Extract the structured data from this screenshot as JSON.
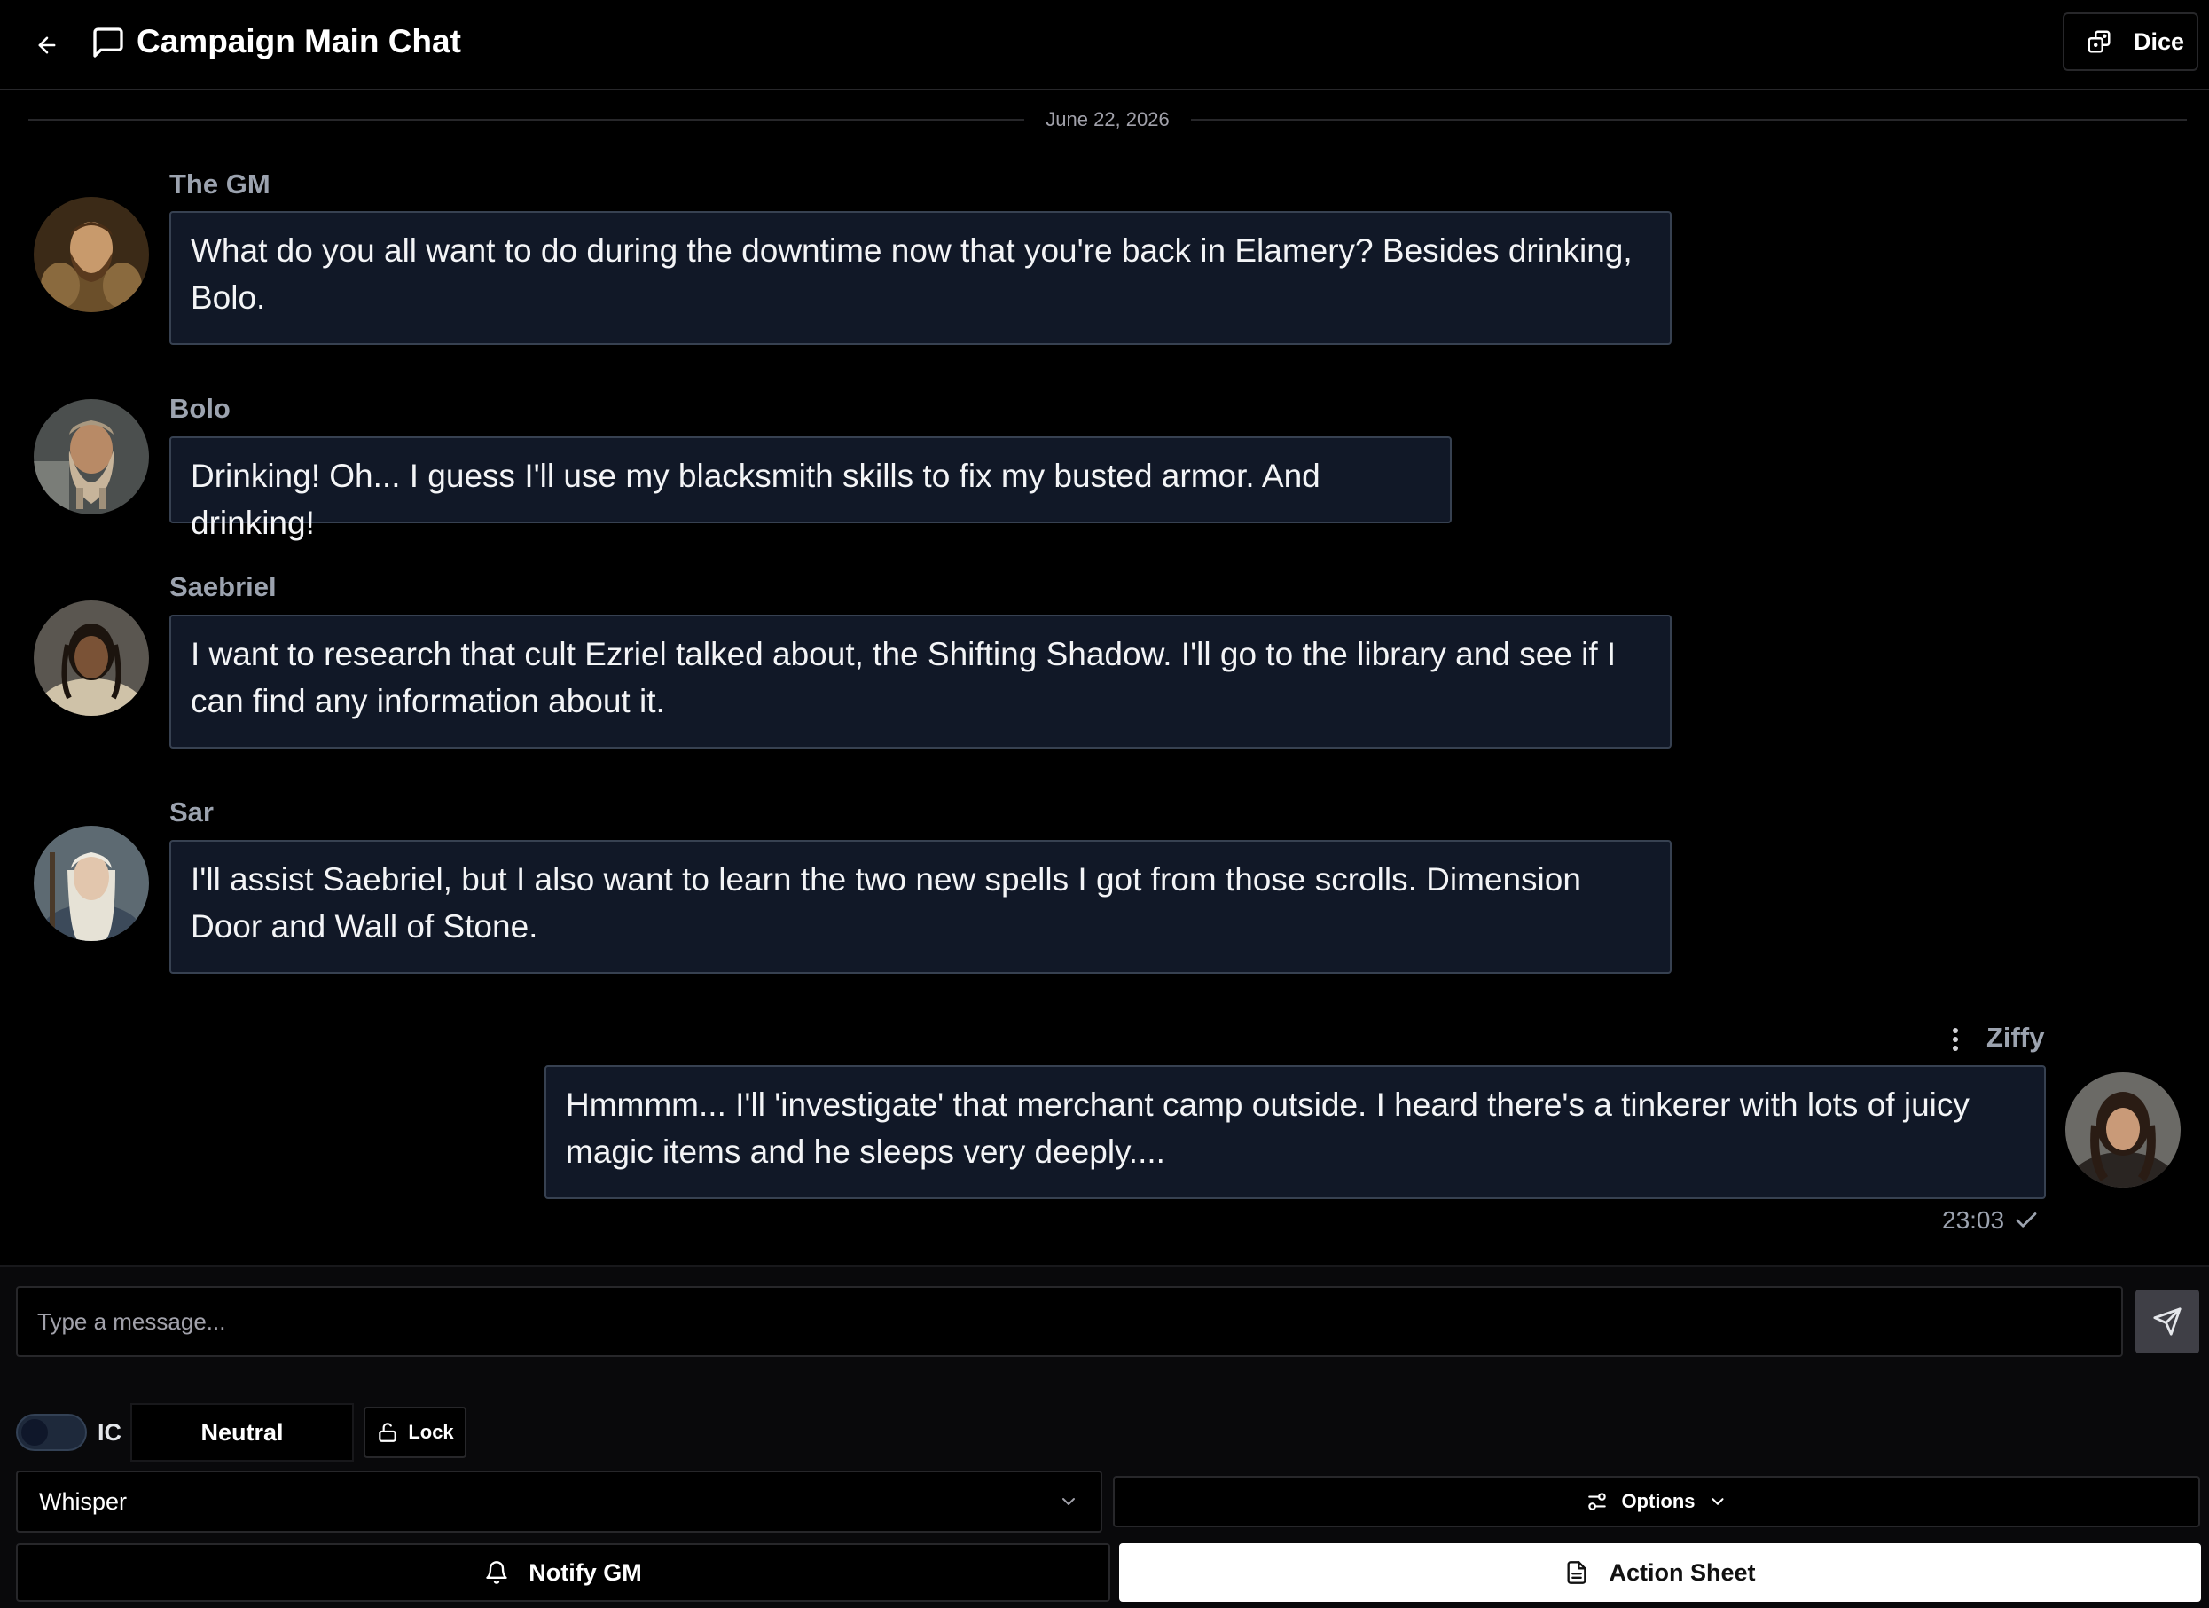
{
  "header": {
    "title": "Campaign Main Chat",
    "dice_label": "Dice"
  },
  "date_divider": "June 22, 2026",
  "messages": [
    {
      "sender": "The GM",
      "text": "What do you all want to do during the downtime now that you're back in Elamery? Besides drinking, Bolo.",
      "avatar": "bearded-man-fur-portrait"
    },
    {
      "sender": "Bolo",
      "text": "Drinking! Oh... I guess I'll use my blacksmith skills to fix my busted armor. And drinking!",
      "avatar": "dwarf-warrior-portrait"
    },
    {
      "sender": "Saebriel",
      "text": "I want to research that cult Ezriel talked about, the Shifting Shadow. I'll go to the library and see if I can find any information about it.",
      "avatar": "elf-braids-portrait"
    },
    {
      "sender": "Sar",
      "text": "I'll assist Saebriel, but I also want to learn the two new spells I got from those scrolls. Dimension Door and Wall of Stone.",
      "avatar": "silver-hair-mage-portrait"
    },
    {
      "sender": "Ziffy",
      "text": "Hmmmm... I'll 'investigate' that merchant camp outside. I heard there's a tinkerer with lots of juicy magic items and he sleeps very deeply....",
      "avatar": "rogue-woman-portrait",
      "time": "23:03",
      "own": true
    }
  ],
  "composer": {
    "placeholder": "Type a message...",
    "ic_label": "IC",
    "ic_enabled": false,
    "neutral_label": "Neutral",
    "lock_label": "Lock",
    "whisper_label": "Whisper",
    "options_label": "Options",
    "notify_label": "Notify GM",
    "action_sheet_label": "Action Sheet"
  },
  "colors": {
    "background": "#000000",
    "bubble": "#111827",
    "bubble_border": "#374151",
    "sender": "#9ca3af",
    "accent_button": "#ffffff"
  }
}
